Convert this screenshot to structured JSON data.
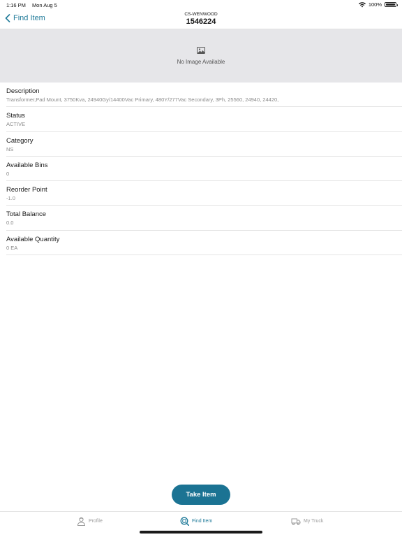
{
  "status_bar": {
    "time": "1:16 PM",
    "date": "Mon Aug 5",
    "battery": "100%",
    "wifi_icon": "wifi-icon",
    "battery_icon": "battery-icon"
  },
  "nav": {
    "back_label": "Find Item",
    "subtitle": "CS-WENWOOD",
    "title": "1546224"
  },
  "image_placeholder": {
    "icon": "image-icon",
    "text": "No Image Available"
  },
  "details": [
    {
      "label": "Description",
      "value": "Transformer,Pad Mount, 3750Kva, 24940Gy/14400Vac Primary, 480Y/277Vac Secondary, 3Ph, 25560, 24940, 24420,"
    },
    {
      "label": "Status",
      "value": "ACTIVE"
    },
    {
      "label": "Category",
      "value": "NS"
    },
    {
      "label": "Available Bins",
      "value": "0"
    },
    {
      "label": "Reorder Point",
      "value": "-1.0"
    },
    {
      "label": "Total Balance",
      "value": "0.0"
    },
    {
      "label": "Available Quantity",
      "value": "0 EA"
    }
  ],
  "actions": {
    "take_item": "Take Item"
  },
  "tabs": [
    {
      "label": "Profile",
      "icon": "profile-icon",
      "active": false
    },
    {
      "label": "Find Item",
      "icon": "find-item-icon",
      "active": true
    },
    {
      "label": "My Truck",
      "icon": "truck-icon",
      "active": false
    }
  ],
  "colors": {
    "accent": "#1f7a99",
    "button": "#1b7393",
    "placeholder_bg": "#e6e6e9"
  }
}
